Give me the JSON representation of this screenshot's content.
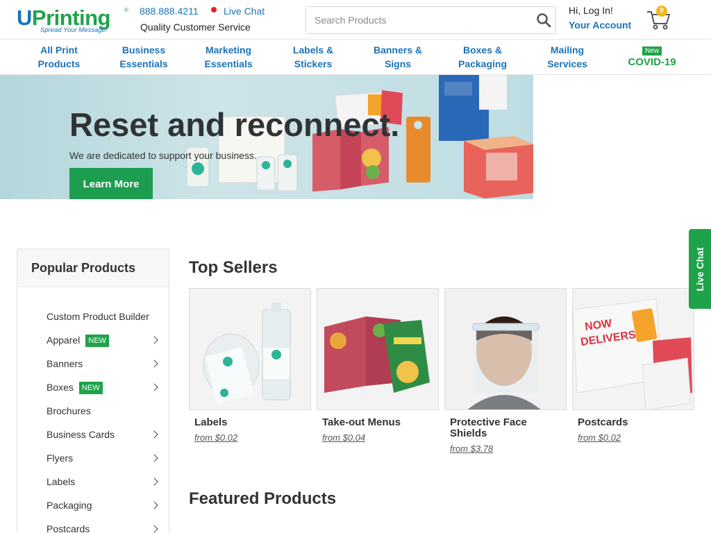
{
  "header": {
    "logo_text_u": "U",
    "logo_text_rest": "Printing",
    "logo_registered": "®",
    "logo_tagline": "Spread Your Message!",
    "phone": "888.888.4211",
    "live_chat": "Live Chat",
    "quality_service": "Quality Customer Service",
    "search_placeholder": "Search Products",
    "login": "Hi, Log In!",
    "account": "Your Account",
    "cart_count": "0"
  },
  "nav": {
    "items": [
      {
        "line1": "All Print",
        "line2": "Products"
      },
      {
        "line1": "Business",
        "line2": "Essentials"
      },
      {
        "line1": "Marketing",
        "line2": "Essentials"
      },
      {
        "line1": "Labels &",
        "line2": "Stickers"
      },
      {
        "line1": "Banners &",
        "line2": "Signs"
      },
      {
        "line1": "Boxes &",
        "line2": "Packaging"
      },
      {
        "line1": "Mailing",
        "line2": "Services"
      },
      {
        "line1": "New",
        "line2": "COVID-19"
      }
    ]
  },
  "hero": {
    "title": "Reset and reconnect.",
    "subtitle": "We are dedicated to support your business.",
    "button": "Learn More"
  },
  "sidebar": {
    "title": "Popular Products",
    "items": [
      {
        "label": "Custom Product Builder",
        "badge": "",
        "chevron": false
      },
      {
        "label": "Apparel",
        "badge": "NEW",
        "chevron": true
      },
      {
        "label": "Banners",
        "badge": "",
        "chevron": true
      },
      {
        "label": "Boxes",
        "badge": "NEW",
        "chevron": true
      },
      {
        "label": "Brochures",
        "badge": "",
        "chevron": false
      },
      {
        "label": "Business Cards",
        "badge": "",
        "chevron": true
      },
      {
        "label": "Flyers",
        "badge": "",
        "chevron": true
      },
      {
        "label": "Labels",
        "badge": "",
        "chevron": true
      },
      {
        "label": "Packaging",
        "badge": "",
        "chevron": true
      },
      {
        "label": "Postcards",
        "badge": "",
        "chevron": true
      }
    ]
  },
  "main": {
    "top_sellers_title": "Top Sellers",
    "featured_title": "Featured Products",
    "top_sellers": [
      {
        "name": "Labels",
        "price": "from $0.02"
      },
      {
        "name": "Take-out Menus",
        "price": "from $0.04"
      },
      {
        "name": "Protective Face Shields",
        "price": "from $3.78"
      },
      {
        "name": "Postcards",
        "price": "from $0.02"
      }
    ]
  },
  "live_chat_tab": "Live Chat",
  "colors": {
    "brand_blue": "#1a73b8",
    "brand_green": "#1fa34a",
    "cart_badge": "#f4b619"
  }
}
